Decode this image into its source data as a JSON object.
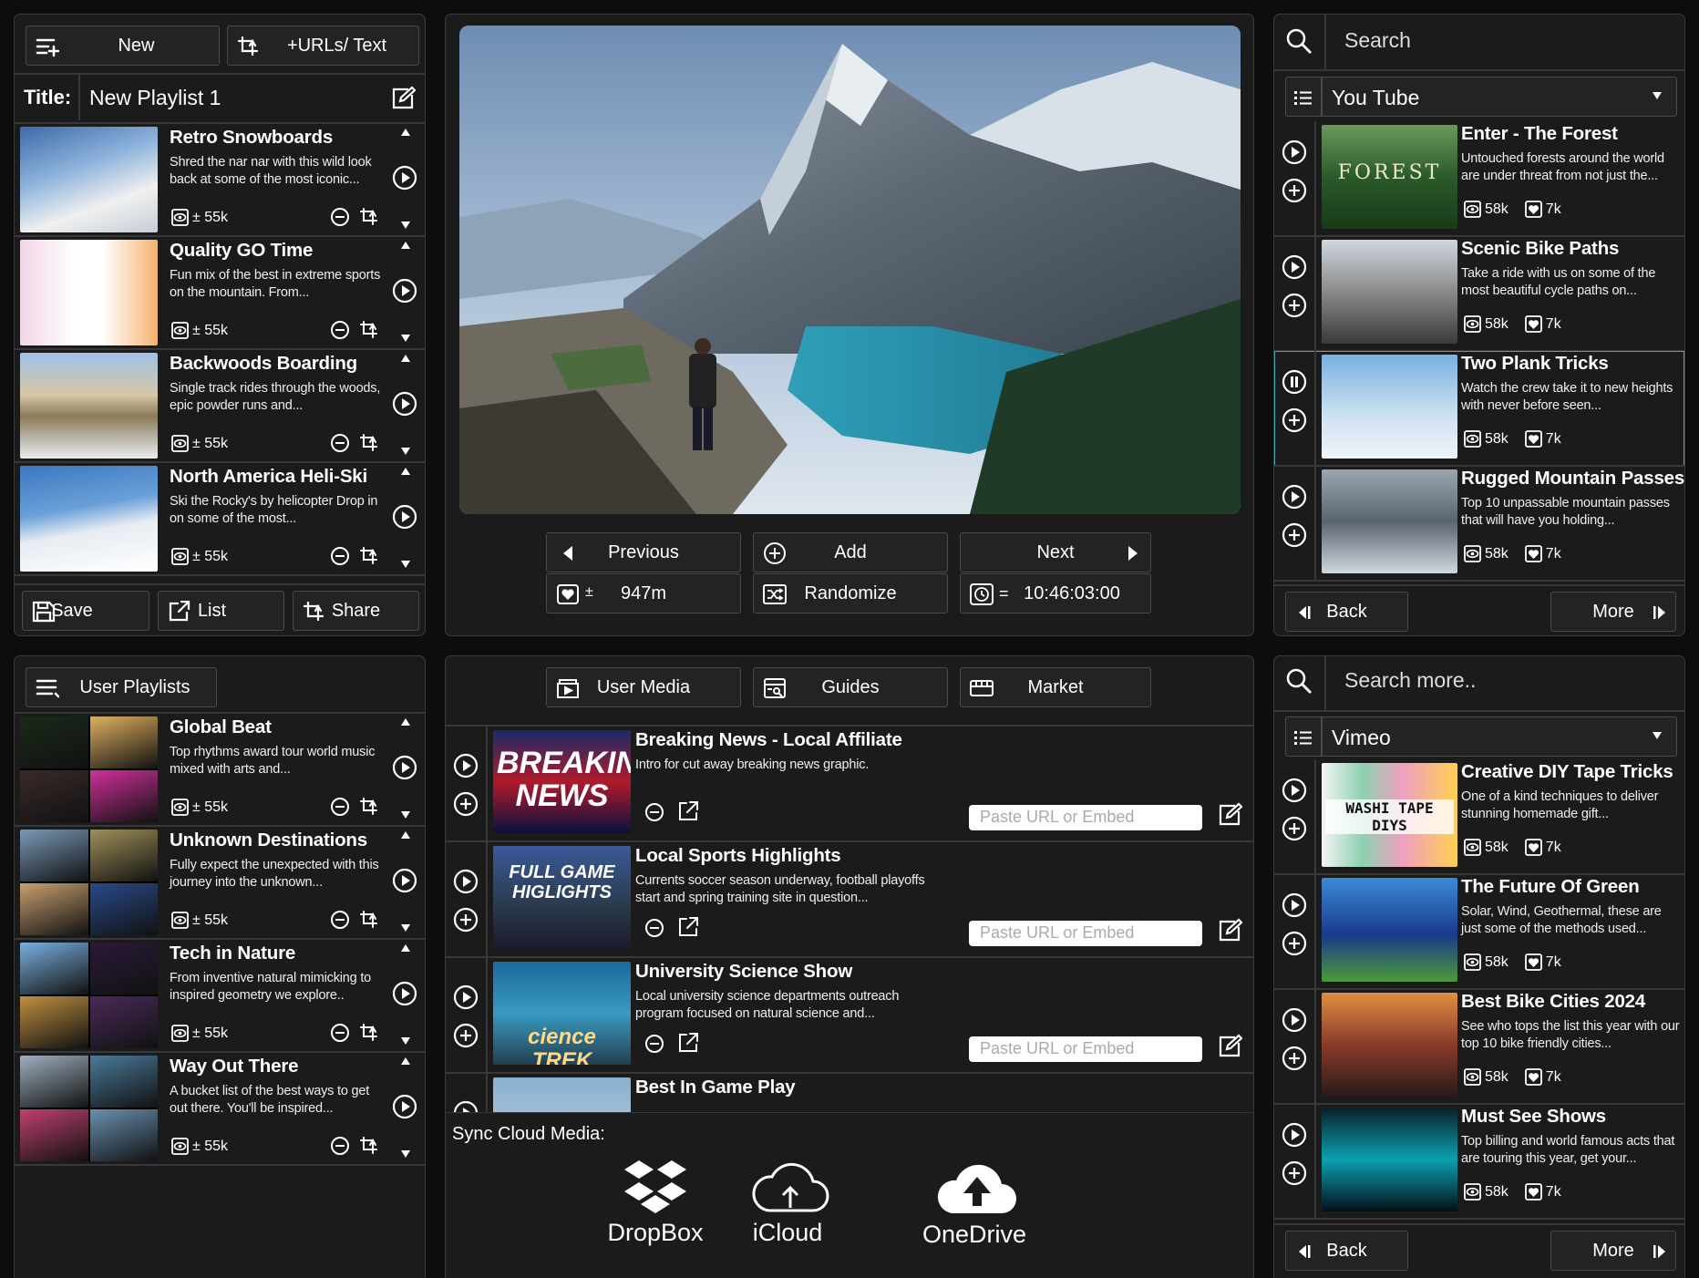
{
  "playlist": {
    "new_label": "New",
    "urls_label": "+URLs/ Text",
    "title_label": "Title:",
    "title_value": "New Playlist 1",
    "items": [
      {
        "title": "Retro Snowboards",
        "desc": "Shred the nar nar with this wild look back at some of the most iconic...",
        "stat": "± 55k"
      },
      {
        "title": "Quality GO Time",
        "desc": "Fun mix of the best in extreme sports on the mountain.  From...",
        "stat": "± 55k"
      },
      {
        "title": "Backwoods Boarding",
        "desc": "Single track rides through the woods, epic powder runs and...",
        "stat": "± 55k"
      },
      {
        "title": "North America Heli-Ski",
        "desc": "Ski the Rocky's by helicopter Drop in on some of the most...",
        "stat": "± 55k"
      }
    ],
    "save_label": "Save",
    "list_label": "List",
    "share_label": "Share"
  },
  "player": {
    "previous_label": "Previous",
    "add_label": "Add",
    "next_label": "Next",
    "duration_prefix": "±",
    "duration": "947m",
    "randomize_label": "Randomize",
    "clock_prefix": "=",
    "clock": "10:46:03:00"
  },
  "search_top": {
    "placeholder": "Search",
    "source": "You Tube",
    "items": [
      {
        "title": "Enter - The Forest",
        "desc": "Untouched forests around the world are under threat from not just the...",
        "views": "58k",
        "likes": "7k"
      },
      {
        "title": "Scenic Bike Paths",
        "desc": "Take a ride with us on some of the most beautiful cycle paths on...",
        "views": "58k",
        "likes": "7k"
      },
      {
        "title": "Two Plank Tricks",
        "desc": "Watch the crew take it to new heights with never before seen...",
        "views": "58k",
        "likes": "7k"
      },
      {
        "title": "Rugged Mountain Passes",
        "desc": "Top 10 unpassable mountain passes that will have you holding...",
        "views": "58k",
        "likes": "7k"
      }
    ],
    "back_label": "Back",
    "more_label": "More",
    "forest_text": "FOREST"
  },
  "user_playlists": {
    "label": "User Playlists",
    "items": [
      {
        "title": "Global Beat",
        "desc": "Top rhythms award tour world music mixed with arts and...",
        "stat": "± 55k"
      },
      {
        "title": "Unknown Destinations",
        "desc": "Fully expect the unexpected with this journey into the unknown...",
        "stat": "± 55k"
      },
      {
        "title": "Tech in Nature",
        "desc": "From inventive natural mimicking to inspired geometry we explore..",
        "stat": "± 55k"
      },
      {
        "title": "Way Out There",
        "desc": "A bucket list of the best ways to get out there.  You'll be inspired...",
        "stat": "± 55k"
      }
    ]
  },
  "media": {
    "tabs": [
      "User Media",
      "Guides",
      "Market"
    ],
    "url_placeholder": "Paste URL or Embed",
    "items": [
      {
        "title": "Breaking News - Local Affiliate",
        "desc": "Intro for cut away breaking news graphic.",
        "thumb_text": "BREAKING NEWS"
      },
      {
        "title": "Local Sports Highlights",
        "desc": "Currents soccer season underway, football playoffs start and spring training site in question...",
        "thumb_text": "FULL GAME HIGLIGHTS"
      },
      {
        "title": "University Science Show",
        "desc": "Local university science departments outreach program focused on natural science and...",
        "thumb_text": "cience TREK"
      },
      {
        "title": "Best In Game Play",
        "desc": ""
      }
    ],
    "sync_label": "Sync Cloud Media:",
    "cloud": [
      "DropBox",
      "iCloud",
      "OneDrive"
    ]
  },
  "search_bottom": {
    "placeholder": "Search more..",
    "source": "Vimeo",
    "items": [
      {
        "title": "Creative DIY Tape Tricks",
        "desc": "One of a kind techniques to deliver stunning homemade gift...",
        "views": "58k",
        "likes": "7k",
        "thumb_text": "WASHI TAPE DIYS"
      },
      {
        "title": "The Future Of Green",
        "desc": "Solar, Wind, Geothermal, these are just some of the methods used...",
        "views": "58k",
        "likes": "7k"
      },
      {
        "title": "Best Bike Cities 2024",
        "desc": "See who tops the list this year with our top 10 bike friendly cities...",
        "views": "58k",
        "likes": "7k"
      },
      {
        "title": "Must See Shows",
        "desc": "Top billing and world famous acts that are touring this year, get your...",
        "views": "58k",
        "likes": "7k"
      }
    ],
    "back_label": "Back",
    "more_label": "More"
  },
  "colors": {
    "background": "#0d0d0d",
    "panel": "#1b1b1b",
    "border": "#3a3a3a",
    "highlight": "#3fa9b8"
  }
}
